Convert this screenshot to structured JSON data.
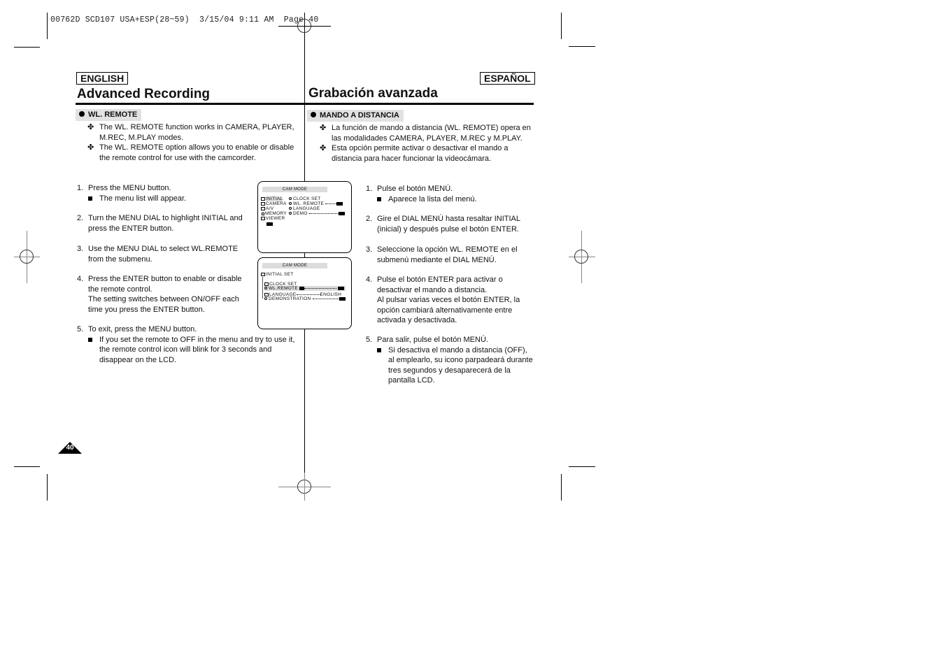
{
  "slug": "00762D SCD107 USA+ESP(28~59)  3/15/04 9:11 AM  Page 40",
  "english": {
    "lang_label": "ENGLISH",
    "title": "Advanced Recording",
    "section": "WL. REMOTE",
    "intro_bullets": [
      "The WL. REMOTE function works in CAMERA, PLAYER, M.REC, M.PLAY modes.",
      "The WL. REMOTE option allows you to enable or disable the remote control for use with the camcorder."
    ],
    "steps": [
      {
        "num": "1.",
        "text": "Press the MENU button.",
        "sub": "The menu list will appear."
      },
      {
        "num": "2.",
        "text": "Turn the MENU DIAL to highlight INITIAL and press the ENTER button."
      },
      {
        "num": "3.",
        "text": "Use the MENU DIAL to select WL.REMOTE from the submenu."
      },
      {
        "num": "4.",
        "text": "Press the ENTER button to enable or disable the remote control.",
        "extra": "The setting switches between ON/OFF each time you press the ENTER button."
      },
      {
        "num": "5.",
        "text": "To exit, press the MENU button.",
        "sub": "If you set the remote to OFF in the menu and try to use it, the remote control icon will blink for 3 seconds and disappear on the LCD."
      }
    ]
  },
  "spanish": {
    "lang_label": "ESPAÑOL",
    "title": "Grabación avanzada",
    "section": "MANDO A DISTANCIA",
    "intro_bullets": [
      "La función de mando a distancia (WL. REMOTE) opera en las modalidades CAMERA, PLAYER, M.REC y M.PLAY.",
      "Esta opción permite activar o desactivar el mando a distancia para hacer funcionar la videocámara."
    ],
    "steps": [
      {
        "num": "1.",
        "text": "Pulse el botón MENÚ.",
        "sub": "Aparece la lista del menú."
      },
      {
        "num": "2.",
        "text": "Gire el DIAL MENÚ hasta resaltar INITIAL (inicial) y después pulse el botón ENTER."
      },
      {
        "num": "3.",
        "text": "Seleccione la opción WL. REMOTE en el submenú mediante el DIAL MENÚ."
      },
      {
        "num": "4.",
        "text": "Pulse el botón ENTER para activar o desactivar el mando a distancia.",
        "extra": "Al pulsar varias veces el botón ENTER, la opción cambiará alternativamente entre activada y desactivada."
      },
      {
        "num": "5.",
        "text": "Para salir, pulse el botón MENÚ.",
        "sub": "Si desactiva el mando a distancia (OFF), al emplearlo, su icono parpadeará durante tres segundos y desaparecerá de la pantalla LCD."
      }
    ]
  },
  "lcd1": {
    "header": "CAM MODE",
    "menu": [
      "INITIAL",
      "CAMERA",
      "A/V",
      "MEMORY",
      "VIEWER"
    ],
    "submenu": [
      "CLOCK SET",
      "WL. REMOTE",
      "LANGUAGE",
      "DEMO"
    ]
  },
  "lcd2": {
    "header": "CAM MODE",
    "group": "INITIAL SET",
    "items": [
      "CLOCK SET",
      "WL.REMOTE",
      "LANGUAGE",
      "DEMONSTRATION"
    ],
    "language_value": "ENGLISH"
  },
  "page_number": "40",
  "bullet_glyph": "✤"
}
